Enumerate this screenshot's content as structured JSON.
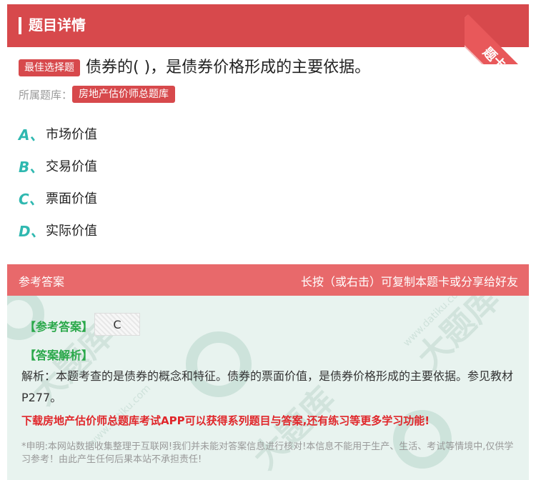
{
  "header": {
    "title": "题目详情",
    "corner_label": "题卡"
  },
  "question": {
    "type_tag": "最佳选择题",
    "text": "债券的(    )，是债券价格形成的主要依据。",
    "bank_label": "所属题库：",
    "bank_name": "房地产估价师总题库"
  },
  "options": [
    {
      "letter": "A、",
      "text": "市场价值"
    },
    {
      "letter": "B、",
      "text": "交易价值"
    },
    {
      "letter": "C、",
      "text": "票面价值"
    },
    {
      "letter": "D、",
      "text": "实际价值"
    }
  ],
  "answer_section": {
    "title": "参考答案",
    "share_hint": "长按（或右击）可复制本题卡或分享给好友",
    "ref_answer_label": "【参考答案】",
    "ref_answer_value": "C",
    "explanation_label": "【答案解析】",
    "explanation": "解析：本题考查的是债券的概念和特征。债券的票面价值，是债券价格形成的主要依据。参见教材P277。",
    "promo": "下载房地产估价师总题库考试APP可以获得系列题目与答案,还有练习等更多学习功能!",
    "disclaimer": "*申明:本网站数据收集整理于互联网!我们并未能对答案信息进行核对!本信息不能用于生产、生活、考试等情境中,仅供学习参考！由此产生任何后果本站不承担责任!"
  },
  "colors": {
    "brand_red": "#d7494c",
    "option_letter": "#2fb8b0",
    "label_green": "#2aa84a",
    "promo_red": "#e0262a"
  }
}
